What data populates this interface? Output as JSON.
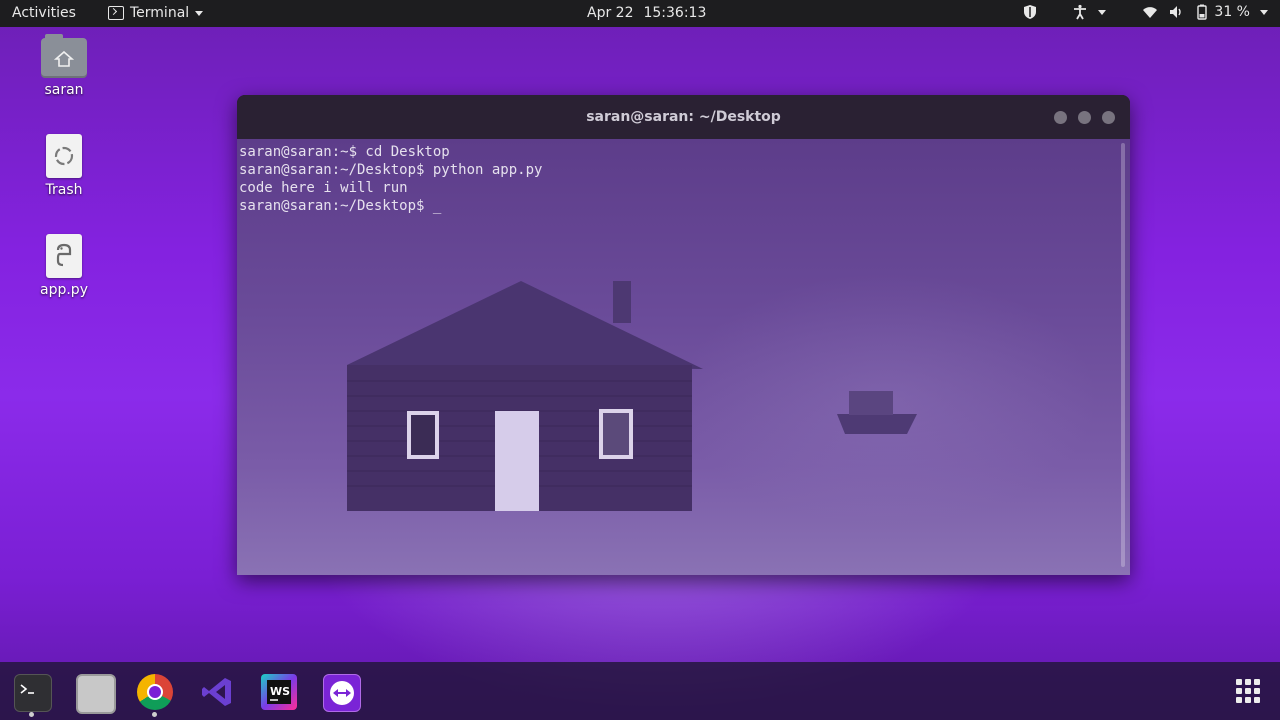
{
  "topbar": {
    "activities": "Activities",
    "app_name": "Terminal",
    "date": "Apr 22",
    "time": "15:36:13",
    "battery": "31 %",
    "tray_icons": [
      "shield-icon",
      "accessibility-icon",
      "wifi-icon",
      "volume-icon",
      "battery-icon"
    ]
  },
  "desktop_icons": [
    {
      "label": "saran",
      "icon": "home-folder-icon"
    },
    {
      "label": "Trash",
      "icon": "trash-icon"
    },
    {
      "label": "app.py",
      "icon": "python-file-icon"
    }
  ],
  "terminal": {
    "title": "saran@saran: ~/Desktop",
    "lines": [
      "saran@saran:~$ cd Desktop",
      "saran@saran:~/Desktop$ python app.py",
      "code here i will run",
      "saran@saran:~/Desktop$ _"
    ]
  },
  "dock": {
    "items": [
      "terminal-icon",
      "files-icon",
      "chrome-icon",
      "vscode-icon",
      "webstorm-icon",
      "teamviewer-icon"
    ],
    "show_apps": "show-applications-icon"
  },
  "colors": {
    "topbar": "#1d1d1f",
    "wallpaper_purple": "#8422e0",
    "terminal_title": "#2a2133"
  }
}
